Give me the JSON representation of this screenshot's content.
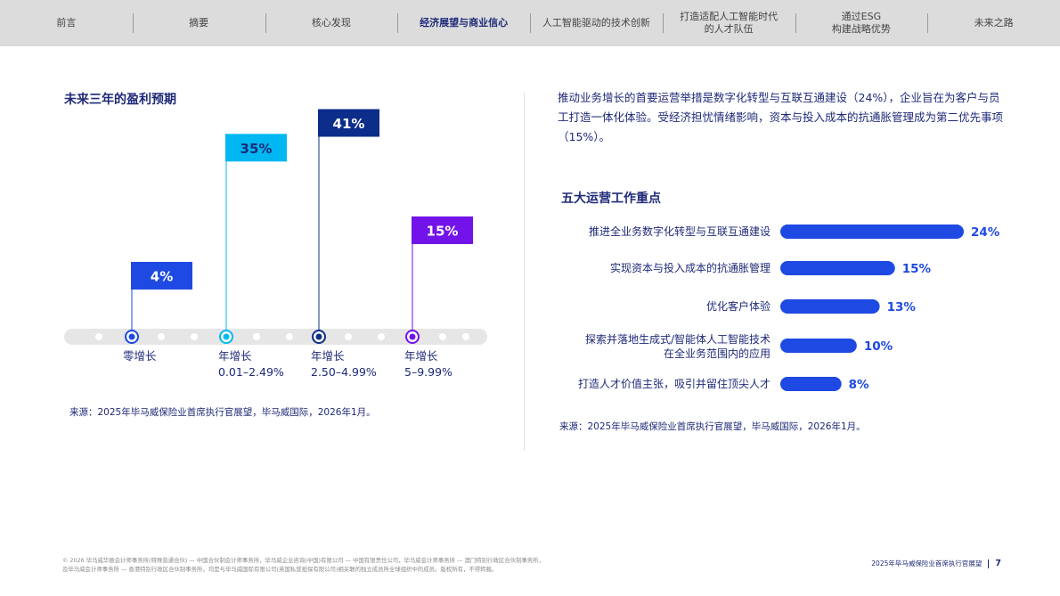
{
  "nav": {
    "items": [
      {
        "label": "前言",
        "active": false
      },
      {
        "label": "摘要",
        "active": false
      },
      {
        "label": "核心发现",
        "active": false
      },
      {
        "label": "经济展望与商业信心",
        "active": true
      },
      {
        "label": "人工智能驱动的技术创新",
        "active": false
      },
      {
        "label": "打造适配人工智能时代\n的人才队伍",
        "active": false
      },
      {
        "label": "通过ESG\n构建战略优势",
        "active": false
      },
      {
        "label": "未来之路",
        "active": false
      }
    ]
  },
  "left": {
    "title": "未来三年的盈利预期",
    "source": "来源：2025年毕马威保险业首席执行官展望，毕马威国际，2026年1月。"
  },
  "right": {
    "paragraph": "推动业务增长的首要运营举措是数字化转型与互联互通建设（24%），企业旨在为客户与员工打造一体化体验。受经济担忧情绪影响，资本与投入成本的抗通胀管理成为第二优先事项（15%）。",
    "title": "五大运营工作重点",
    "source": "来源：2025年毕马威保险业首席执行官展望，毕马威国际，2026年1月。"
  },
  "chart_data": [
    {
      "type": "bar",
      "title": "未来三年的盈利预期",
      "categories": [
        "零增长",
        "年增长\n0.01–2.49%",
        "年增长\n2.50–4.99%",
        "年增长\n5–9.99%"
      ],
      "values": [
        4,
        35,
        41,
        15
      ],
      "value_labels": [
        "4%",
        "35%",
        "41%",
        "15%"
      ],
      "colors": [
        "#1e49e2",
        "#00b8f1",
        "#0c2d8a",
        "#7213ea"
      ],
      "unit": "%"
    },
    {
      "type": "bar",
      "orientation": "horizontal",
      "title": "五大运营工作重点",
      "categories": [
        "推进全业务数字化转型与互联互通建设",
        "实现资本与投入成本的抗通胀管理",
        "优化客户体验",
        "探索并落地生成式/智能体人工智能技术\n在全业务范围内的应用",
        "打造人才价值主张，吸引并留住顶尖人才"
      ],
      "values": [
        24,
        15,
        13,
        10,
        8
      ],
      "value_labels": [
        "24%",
        "15%",
        "13%",
        "10%",
        "8%"
      ],
      "color": "#1e49e2",
      "unit": "%"
    }
  ],
  "footer": {
    "legal": "© 2026 毕马威华振会计师事务所(特殊普通合伙) — 中国合伙制会计师事务所，毕马威企业咨询(中国)有限公司 — 中国有限责任公司，毕马威会计师事务所 — 澳门特别行政区合伙制事务所，\n及毕马威会计师事务所 — 香港特别行政区合伙制事务所，均是与毕马威国际有限公司(英国私营担保有限公司)相关联的独立成员所全球组织中的成员。版权所有，不得转载。",
    "report_title": "2025年毕马威保险业首席执行官展望",
    "page_number": "7"
  }
}
